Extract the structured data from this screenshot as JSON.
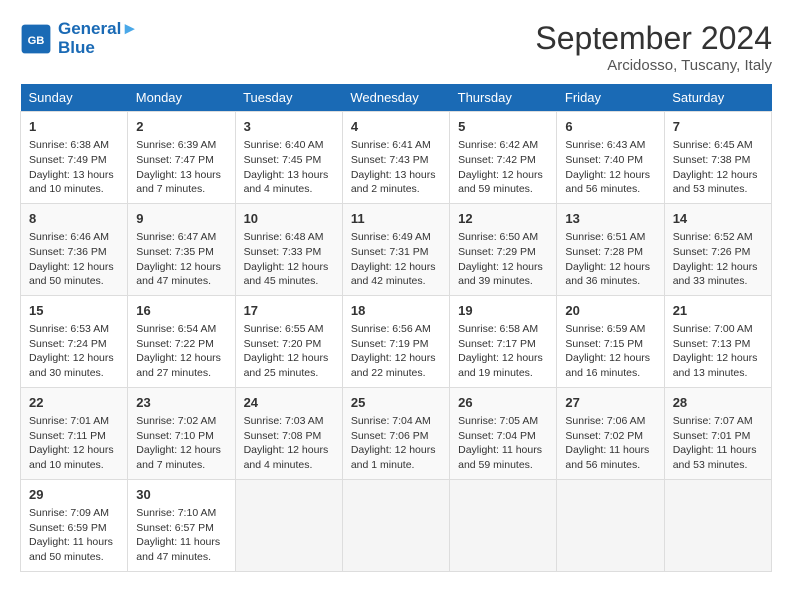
{
  "header": {
    "logo_line1": "General",
    "logo_line2": "Blue",
    "month_title": "September 2024",
    "subtitle": "Arcidosso, Tuscany, Italy"
  },
  "days_of_week": [
    "Sunday",
    "Monday",
    "Tuesday",
    "Wednesday",
    "Thursday",
    "Friday",
    "Saturday"
  ],
  "weeks": [
    [
      {
        "day": 1,
        "sunrise": "6:38 AM",
        "sunset": "7:49 PM",
        "daylight": "13 hours and 10 minutes."
      },
      {
        "day": 2,
        "sunrise": "6:39 AM",
        "sunset": "7:47 PM",
        "daylight": "13 hours and 7 minutes."
      },
      {
        "day": 3,
        "sunrise": "6:40 AM",
        "sunset": "7:45 PM",
        "daylight": "13 hours and 4 minutes."
      },
      {
        "day": 4,
        "sunrise": "6:41 AM",
        "sunset": "7:43 PM",
        "daylight": "13 hours and 2 minutes."
      },
      {
        "day": 5,
        "sunrise": "6:42 AM",
        "sunset": "7:42 PM",
        "daylight": "12 hours and 59 minutes."
      },
      {
        "day": 6,
        "sunrise": "6:43 AM",
        "sunset": "7:40 PM",
        "daylight": "12 hours and 56 minutes."
      },
      {
        "day": 7,
        "sunrise": "6:45 AM",
        "sunset": "7:38 PM",
        "daylight": "12 hours and 53 minutes."
      }
    ],
    [
      {
        "day": 8,
        "sunrise": "6:46 AM",
        "sunset": "7:36 PM",
        "daylight": "12 hours and 50 minutes."
      },
      {
        "day": 9,
        "sunrise": "6:47 AM",
        "sunset": "7:35 PM",
        "daylight": "12 hours and 47 minutes."
      },
      {
        "day": 10,
        "sunrise": "6:48 AM",
        "sunset": "7:33 PM",
        "daylight": "12 hours and 45 minutes."
      },
      {
        "day": 11,
        "sunrise": "6:49 AM",
        "sunset": "7:31 PM",
        "daylight": "12 hours and 42 minutes."
      },
      {
        "day": 12,
        "sunrise": "6:50 AM",
        "sunset": "7:29 PM",
        "daylight": "12 hours and 39 minutes."
      },
      {
        "day": 13,
        "sunrise": "6:51 AM",
        "sunset": "7:28 PM",
        "daylight": "12 hours and 36 minutes."
      },
      {
        "day": 14,
        "sunrise": "6:52 AM",
        "sunset": "7:26 PM",
        "daylight": "12 hours and 33 minutes."
      }
    ],
    [
      {
        "day": 15,
        "sunrise": "6:53 AM",
        "sunset": "7:24 PM",
        "daylight": "12 hours and 30 minutes."
      },
      {
        "day": 16,
        "sunrise": "6:54 AM",
        "sunset": "7:22 PM",
        "daylight": "12 hours and 27 minutes."
      },
      {
        "day": 17,
        "sunrise": "6:55 AM",
        "sunset": "7:20 PM",
        "daylight": "12 hours and 25 minutes."
      },
      {
        "day": 18,
        "sunrise": "6:56 AM",
        "sunset": "7:19 PM",
        "daylight": "12 hours and 22 minutes."
      },
      {
        "day": 19,
        "sunrise": "6:58 AM",
        "sunset": "7:17 PM",
        "daylight": "12 hours and 19 minutes."
      },
      {
        "day": 20,
        "sunrise": "6:59 AM",
        "sunset": "7:15 PM",
        "daylight": "12 hours and 16 minutes."
      },
      {
        "day": 21,
        "sunrise": "7:00 AM",
        "sunset": "7:13 PM",
        "daylight": "12 hours and 13 minutes."
      }
    ],
    [
      {
        "day": 22,
        "sunrise": "7:01 AM",
        "sunset": "7:11 PM",
        "daylight": "12 hours and 10 minutes."
      },
      {
        "day": 23,
        "sunrise": "7:02 AM",
        "sunset": "7:10 PM",
        "daylight": "12 hours and 7 minutes."
      },
      {
        "day": 24,
        "sunrise": "7:03 AM",
        "sunset": "7:08 PM",
        "daylight": "12 hours and 4 minutes."
      },
      {
        "day": 25,
        "sunrise": "7:04 AM",
        "sunset": "7:06 PM",
        "daylight": "12 hours and 1 minute."
      },
      {
        "day": 26,
        "sunrise": "7:05 AM",
        "sunset": "7:04 PM",
        "daylight": "11 hours and 59 minutes."
      },
      {
        "day": 27,
        "sunrise": "7:06 AM",
        "sunset": "7:02 PM",
        "daylight": "11 hours and 56 minutes."
      },
      {
        "day": 28,
        "sunrise": "7:07 AM",
        "sunset": "7:01 PM",
        "daylight": "11 hours and 53 minutes."
      }
    ],
    [
      {
        "day": 29,
        "sunrise": "7:09 AM",
        "sunset": "6:59 PM",
        "daylight": "11 hours and 50 minutes."
      },
      {
        "day": 30,
        "sunrise": "7:10 AM",
        "sunset": "6:57 PM",
        "daylight": "11 hours and 47 minutes."
      },
      null,
      null,
      null,
      null,
      null
    ]
  ]
}
